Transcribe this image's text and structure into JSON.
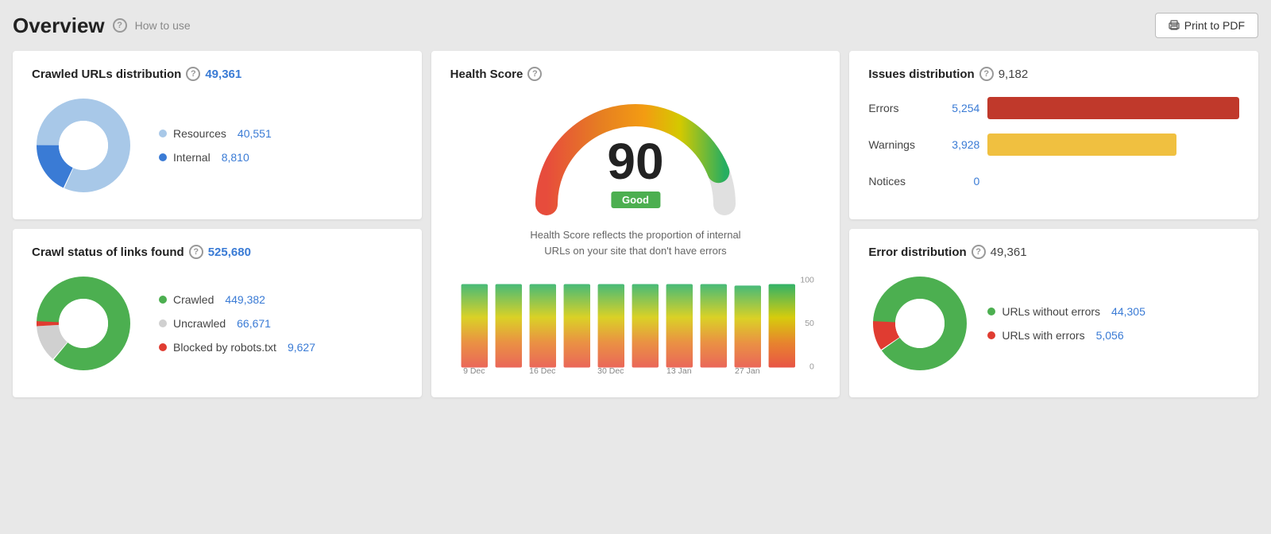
{
  "header": {
    "title": "Overview",
    "help_label": "?",
    "how_to_use": "How to use",
    "print_btn": "Print to PDF"
  },
  "crawled_urls": {
    "title": "Crawled URLs distribution",
    "total": "49,361",
    "legend": [
      {
        "label": "Resources",
        "value": "40,551",
        "color": "#a8c8e8"
      },
      {
        "label": "Internal",
        "value": "8,810",
        "color": "#3a7bd5"
      }
    ]
  },
  "health_score": {
    "title": "Health Score",
    "score": "90",
    "badge": "Good",
    "description": "Health Score reflects the proportion of internal URLs on your site that don't have errors",
    "history_labels": [
      "9 Dec",
      "16 Dec",
      "30 Dec",
      "13 Jan",
      "27 Jan"
    ],
    "y_labels": [
      "100",
      "50",
      "0"
    ]
  },
  "issues_distribution": {
    "title": "Issues distribution",
    "total": "9,182",
    "rows": [
      {
        "label": "Errors",
        "value": "5,254",
        "color": "#c0392b",
        "pct": 100
      },
      {
        "label": "Warnings",
        "value": "3,928",
        "color": "#f0c040",
        "pct": 75
      },
      {
        "label": "Notices",
        "value": "0",
        "color": "#aaa",
        "pct": 0
      }
    ]
  },
  "crawl_status": {
    "title": "Crawl status of links found",
    "total": "525,680",
    "legend": [
      {
        "label": "Crawled",
        "value": "449,382",
        "color": "#4caf50"
      },
      {
        "label": "Uncrawled",
        "value": "66,671",
        "color": "#d0d0d0"
      },
      {
        "label": "Blocked by robots.txt",
        "value": "9,627",
        "color": "#e03c31"
      }
    ]
  },
  "error_distribution": {
    "title": "Error distribution",
    "total": "49,361",
    "legend": [
      {
        "label": "URLs without errors",
        "value": "44,305",
        "color": "#4caf50"
      },
      {
        "label": "URLs with errors",
        "value": "5,056",
        "color": "#e03c31"
      }
    ]
  },
  "icons": {
    "print": "🖨"
  }
}
